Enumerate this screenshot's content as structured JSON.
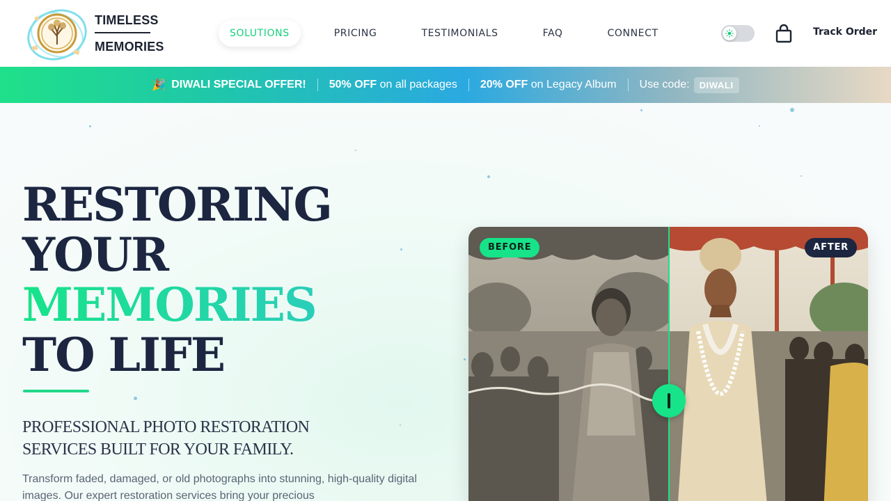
{
  "brand": {
    "line1": "TIMELESS",
    "line2": "MEMORIES"
  },
  "nav": {
    "items": [
      {
        "label": "SOLUTIONS",
        "active": true
      },
      {
        "label": "PRICING",
        "active": false
      },
      {
        "label": "TESTIMONIALS",
        "active": false
      },
      {
        "label": "FAQ",
        "active": false
      },
      {
        "label": "CONNECT",
        "active": false
      }
    ],
    "track_order": "Track Order"
  },
  "icons": {
    "theme_toggle": "sun-icon",
    "cart": "shopping-bag-icon",
    "offer": "party-popper-icon",
    "slider": "drag-handle-icon"
  },
  "offer_bar": {
    "emoji": "🎉",
    "title": "DIWALI SPECIAL OFFER!",
    "deal1_bold": "50% OFF",
    "deal1_rest": "on all packages",
    "deal2_bold": "20% OFF",
    "deal2_rest": "on Legacy Album",
    "code_label": "Use code:",
    "code": "DIWALI"
  },
  "hero": {
    "headline": [
      "RESTORING",
      "YOUR",
      "MEMORIES",
      "TO LIFE"
    ],
    "subhead": [
      "PROFESSIONAL PHOTO RESTORATION",
      "SERVICES BUILT FOR YOUR FAMILY."
    ],
    "paragraph": "Transform faded, damaged, or old photographs into stunning, high-quality digital images. Our expert restoration services bring your precious"
  },
  "compare": {
    "before_label": "BEFORE",
    "after_label": "AFTER",
    "split_fraction": 0.5
  },
  "colors": {
    "accent": "#17e389",
    "navy": "#1c2640",
    "text": "#2b3445"
  }
}
